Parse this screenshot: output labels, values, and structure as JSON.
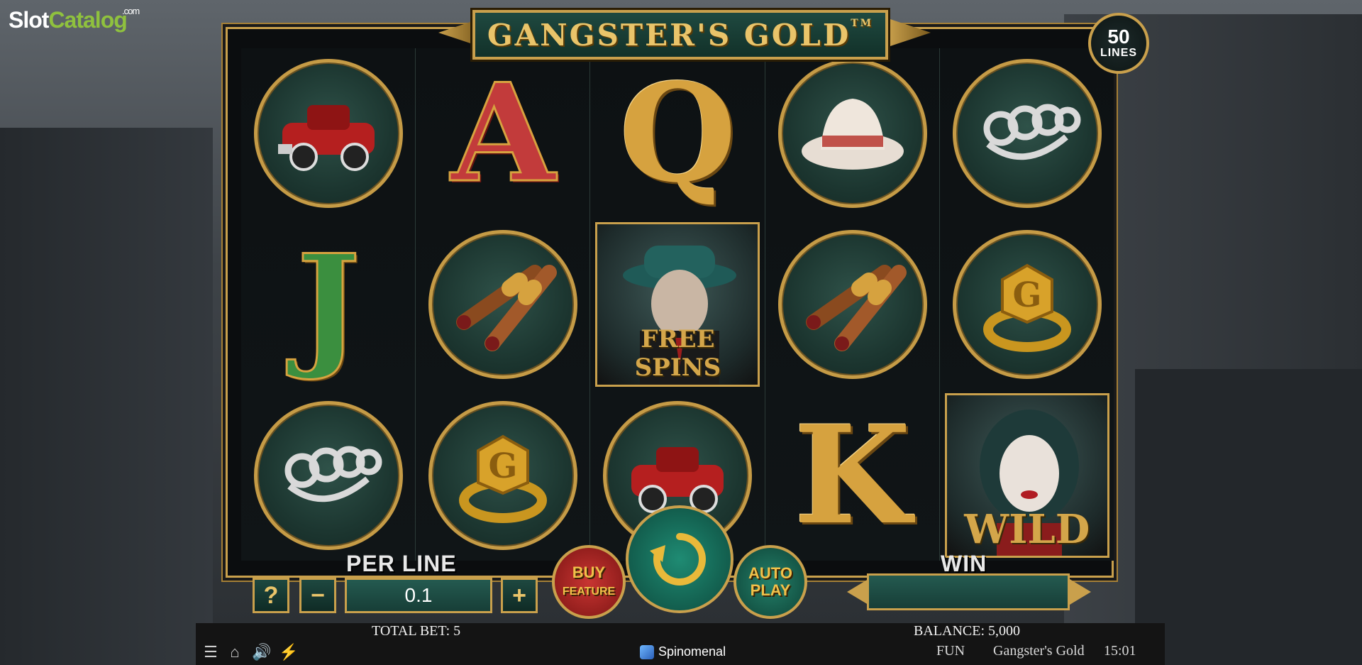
{
  "watermark": {
    "brand_a": "Slot",
    "brand_b": "Catalog",
    "suffix": ".com"
  },
  "game": {
    "title": "GANGSTER'S GOLD",
    "trademark": "TM"
  },
  "lines_badge": {
    "count": "50",
    "label": "LINES"
  },
  "reels": [
    {
      "symbols": [
        "red-car",
        "J",
        "brass-knuckles"
      ]
    },
    {
      "symbols": [
        "A",
        "cigars",
        "gold-ring"
      ]
    },
    {
      "symbols": [
        "Q",
        "free-spins-gangster",
        "red-car"
      ]
    },
    {
      "symbols": [
        "fedora-hat",
        "cigars",
        "K"
      ]
    },
    {
      "symbols": [
        "brass-knuckles",
        "gold-ring",
        "wild-woman"
      ]
    }
  ],
  "symbol_labels": {
    "free_spins": "FREE SPINS",
    "wild": "WILD",
    "letter_a": "A",
    "letter_q": "Q",
    "letter_j": "J",
    "letter_k": "K"
  },
  "controls": {
    "per_line_label": "PER LINE",
    "help": "?",
    "minus": "−",
    "plus": "+",
    "per_line_value": "0.1",
    "buy_feature_line1": "BUY",
    "buy_feature_line2": "FEATURE",
    "auto_play_line1": "AUTO",
    "auto_play_line2": "PLAY",
    "win_label": "WIN",
    "win_value": ""
  },
  "status_bar": {
    "total_bet": "TOTAL BET: 5",
    "balance": "BALANCE: 5,000",
    "mode": "FUN",
    "game_name": "Gangster's Gold",
    "time": "15:01",
    "provider": "Spinomenal"
  },
  "icons": [
    "menu-icon",
    "home-icon",
    "sound-icon",
    "turbo-icon",
    "spin-arrow-icon",
    "provider-logo-icon"
  ],
  "colors": {
    "gold": "#c9a04c",
    "teal": "#1e4840",
    "red": "#c83532"
  }
}
